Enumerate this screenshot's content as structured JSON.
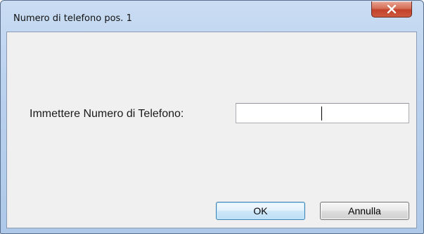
{
  "window": {
    "title": "Numero di telefono pos. 1"
  },
  "icons": {
    "close": "close-icon"
  },
  "form": {
    "phone_label": "Immettere Numero di Telefono:",
    "phone_value": ""
  },
  "buttons": {
    "ok_label": "OK",
    "cancel_label": "Annulla"
  },
  "colors": {
    "close_button": "#c7432b",
    "client_background": "#f0f0f0",
    "ok_border": "#3c7fb1"
  }
}
